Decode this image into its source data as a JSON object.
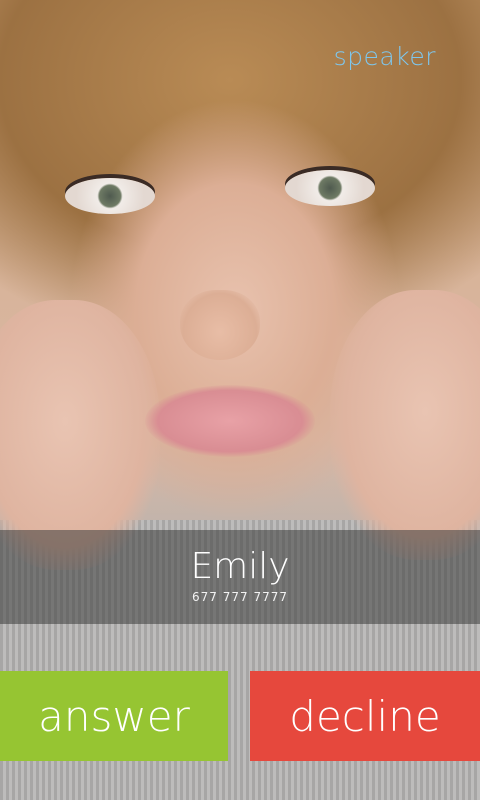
{
  "top_action": {
    "label": "speaker"
  },
  "caller": {
    "name": "Emily",
    "number": "677 777 7777"
  },
  "actions": {
    "answer_label": "answer",
    "decline_label": "decline"
  },
  "colors": {
    "answer": "#96c532",
    "decline": "#e6483d",
    "speaker": "#7ec7ee"
  }
}
